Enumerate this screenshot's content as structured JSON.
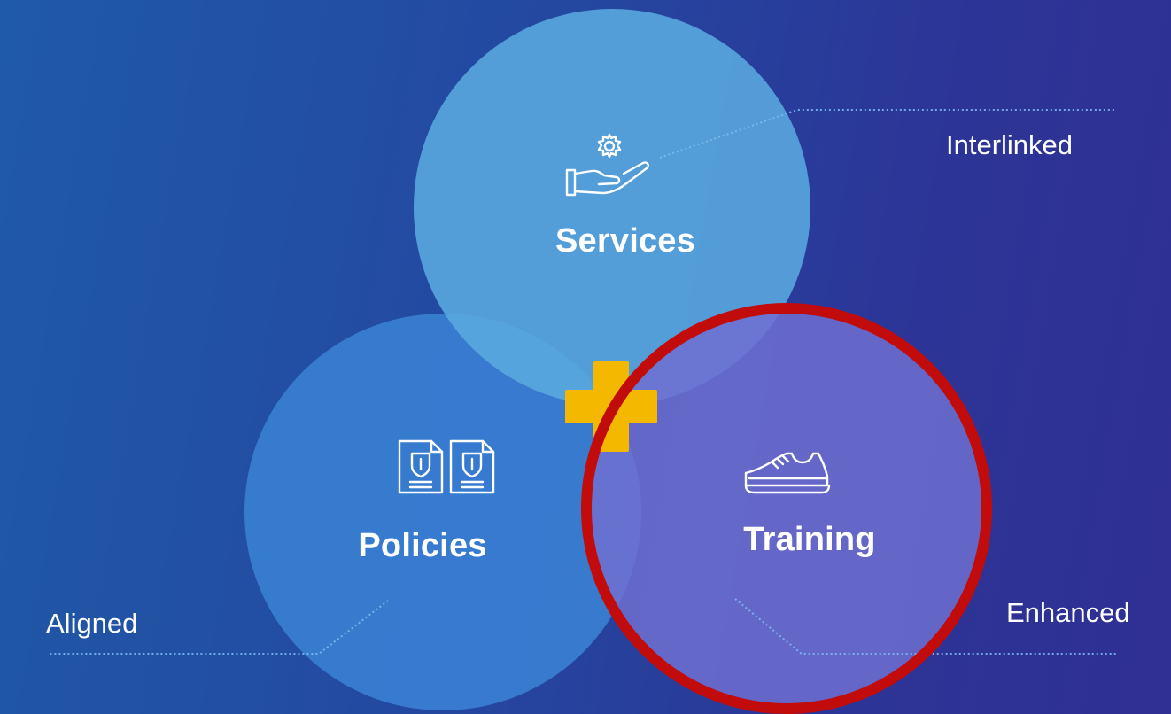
{
  "colors": {
    "background_start": "#1f5aa8",
    "background_end": "#302f92",
    "services_circle": "#5aa7dc",
    "policies_circle": "#3a7fd2",
    "training_circle": "#6a6ccb",
    "plus_sign": "#f5b800",
    "highlight_ring": "#cc0000",
    "connector_line": "#6fb8e8"
  },
  "nodes": {
    "services": {
      "label": "Services",
      "icon": "hand-gear-icon"
    },
    "policies": {
      "label": "Policies",
      "icon": "documents-icon"
    },
    "training": {
      "label": "Training",
      "icon": "sneaker-icon"
    }
  },
  "outer_labels": {
    "interlinked": "Interlinked",
    "aligned": "Aligned",
    "enhanced": "Enhanced"
  },
  "center_icon": "plus-icon",
  "highlight": {
    "target": "training"
  }
}
